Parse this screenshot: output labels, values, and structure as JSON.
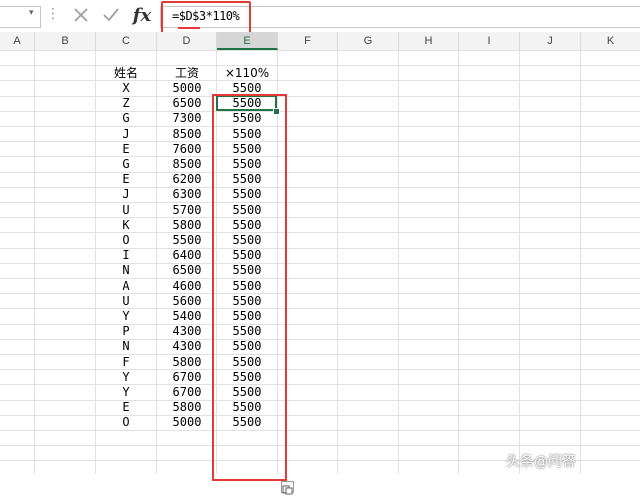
{
  "formula_bar": {
    "name_box_value": "",
    "dropdown_glyph": "▾",
    "more_glyph": "⋮",
    "fx_label": "fx",
    "formula": "=$D$3*110%"
  },
  "columns": [
    "A",
    "B",
    "C",
    "D",
    "E",
    "F",
    "G",
    "H",
    "I",
    "J",
    "K"
  ],
  "selected_column": "E",
  "sheet": {
    "header_name": "姓名",
    "header_salary": "工资",
    "header_result": "×110%",
    "names": [
      "X",
      "Z",
      "G",
      "J",
      "E",
      "G",
      "E",
      "J",
      "U",
      "K",
      "O",
      "I",
      "N",
      "A",
      "U",
      "Y",
      "P",
      "N",
      "F",
      "Y",
      "Y",
      "E",
      "O"
    ],
    "salaries": [
      "5000",
      "6500",
      "7300",
      "8500",
      "7600",
      "8500",
      "6200",
      "6300",
      "5700",
      "5800",
      "5500",
      "6400",
      "6500",
      "4600",
      "5600",
      "5400",
      "4300",
      "4300",
      "5800",
      "6700",
      "6700",
      "5800",
      "5000"
    ],
    "results": [
      "5500",
      "5500",
      "5500",
      "5500",
      "5500",
      "5500",
      "5500",
      "5500",
      "5500",
      "5500",
      "5500",
      "5500",
      "5500",
      "5500",
      "5500",
      "5500",
      "5500",
      "5500",
      "5500",
      "5500",
      "5500",
      "5500",
      "5500"
    ]
  },
  "watermark": "头条@问答"
}
